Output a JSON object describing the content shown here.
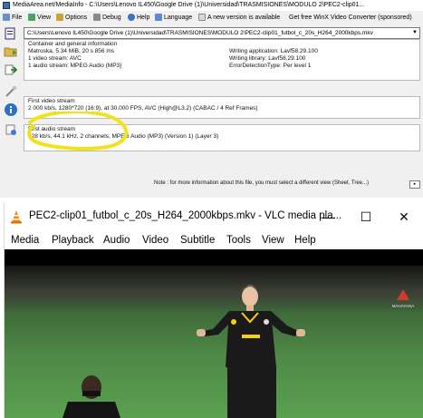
{
  "mediainfo": {
    "title": "MediaArea.net/MediaInfo - C:\\Users\\Lenovo IL450\\Google Drive (1)\\Universidad\\TRASMISIONES\\MODULO 2\\PEC2-clip01...",
    "menu": {
      "file": "File",
      "view": "View",
      "options": "Options",
      "debug": "Debug",
      "help": "Help",
      "language": "Language",
      "new_version": "A new version is available",
      "converter": "Get free WinX Video Converter (sponsored)"
    },
    "path": "C:\\Users\\Lenovo IL450\\Google Drive (1)\\Universidad\\TRASMISIONES\\MODULO 2\\PEC2-clip01_futbol_c_20s_H264_2000kbps.mkv",
    "general": {
      "heading": "Container and general information",
      "rows_left": [
        "Matroska, 5.34 MiB, 20 s 856 ms",
        "1 video stream: AVC",
        "1 audio stream: MPEG Audio (MP3)"
      ],
      "rows_right": [
        "Writing application: Lavf58.29.100",
        "Writing library: Lavf58.29.100",
        "ErrorDetectionType: Per level 1"
      ]
    },
    "video": {
      "heading": "First video stream",
      "details": "2 000 kb/s, 1280*720 (16:9), at 30.000 FPS, AVC (High@L3.2) (CABAC / 4 Ref Frames)"
    },
    "audio": {
      "heading": "First audio stream",
      "details": "128 kb/s, 44.1 kHz, 2 channels, MPEG Audio (MP3) (Version 1) (Layer 3)"
    },
    "note": "Note : for more information about this file, you must select a different view (Sheet, Tree...)"
  },
  "vlc": {
    "title": "PEC2-clip01_futbol_c_20s_H264_2000kbps.mkv - VLC media pla...",
    "minimize": "—",
    "maximize": "☐",
    "close": "✕",
    "menu": [
      "Media",
      "Playback",
      "Audio",
      "Video",
      "Subtitle",
      "Tools",
      "View",
      "Help"
    ],
    "watermark": "MAHAYANA"
  },
  "colors": {
    "highlight": "#f2e21d",
    "vlc_cone": "#f48a10",
    "jersey": "#1a1a1a",
    "jersey_trim": "#f5d300",
    "pitch": "#4f8a47"
  }
}
